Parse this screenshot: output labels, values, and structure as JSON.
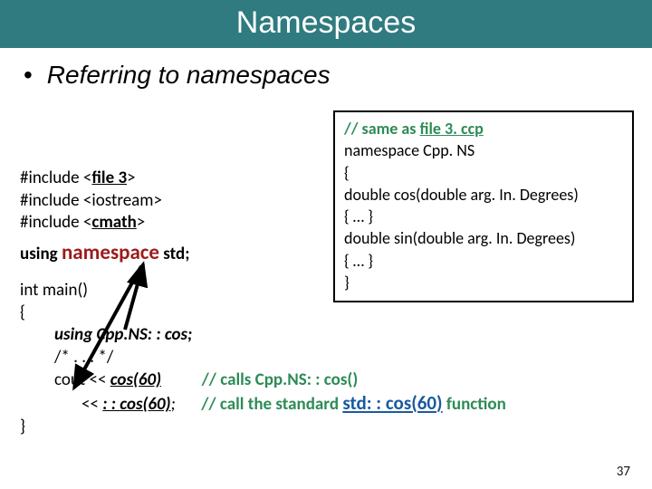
{
  "title": "Namespaces",
  "bullet": "Referring to namespaces",
  "left": {
    "inc1_pre": "#include <",
    "inc1_file": "file 3",
    "inc1_post": ">",
    "inc2": "#include <iostream>",
    "inc3_pre": "#include <",
    "inc3_file": "cmath",
    "inc3_post": ">",
    "using_kw": "using",
    "namespace_kw": "namespace",
    "std_txt": " std;",
    "int_kw": "int",
    "main_sig": " main()",
    "brace_open": "{",
    "using_cos": "using Cpp.NS: : cos;",
    "cmt_stars": "/* . . . */",
    "cout_pre": "cout << ",
    "cos60_a": "cos(60)",
    "cmt_a": "// calls Cpp.NS: : cos()",
    "shift": "   << ",
    "cos60_b": ": : cos(60)",
    "semicolon": ";",
    "cmt_b_pre": "// call the standard ",
    "stdcos": "std: : cos(60)",
    "cmt_b_post": " function",
    "brace_close": "}"
  },
  "box": {
    "c1": "// same as ",
    "c1_file": "file 3. ccp",
    "l2": "namespace Cpp. NS",
    "l3": "{",
    "l4a": "    double cos(double arg. In. Degrees)",
    "l5": "    { … }",
    "l6a": "    double sin(double arg. In. Degrees)",
    "l7": "    { … }",
    "l8": "}"
  },
  "page": "37"
}
